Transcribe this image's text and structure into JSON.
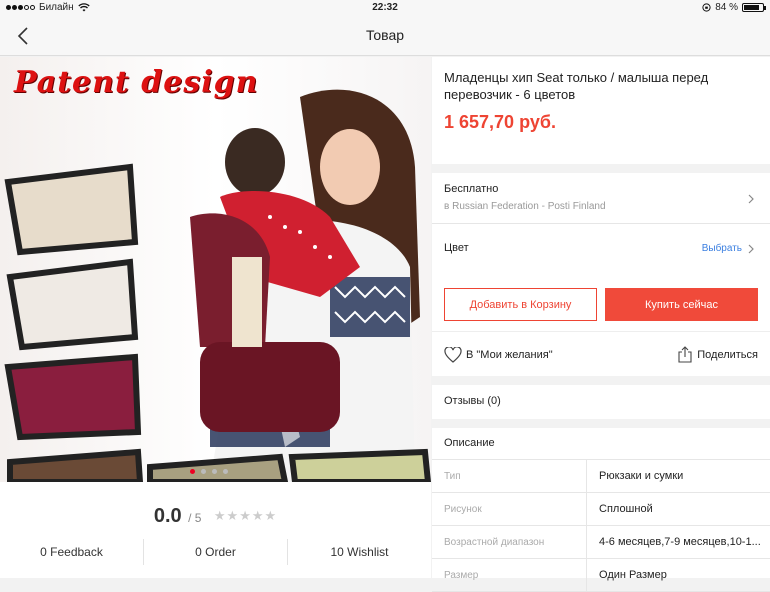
{
  "status": {
    "carrier": "Билайн",
    "time": "22:32",
    "battery": "84 %",
    "battery_level": 0.84
  },
  "nav": {
    "title": "Товар"
  },
  "product": {
    "image_caption": "Patent design",
    "image_count": 4,
    "image_active_index": 0,
    "title": "Младенцы хип Seat только / малыша перед перевозчик - 6 цветов",
    "price": "1 657,70 руб."
  },
  "rating": {
    "score": "0.0",
    "of": "/ 5",
    "stars": "★★★★★",
    "stars_filled": 0
  },
  "stats": [
    {
      "label": "0 Feedback"
    },
    {
      "label": "0 Order"
    },
    {
      "label": "10 Wishlist"
    }
  ],
  "shipping": {
    "cost": "Бесплатно",
    "method": "в Russian Federation - Posti Finland"
  },
  "color": {
    "label": "Цвет",
    "choose": "Выбрать"
  },
  "actions": {
    "add_to_cart": "Добавить в Корзину",
    "buy_now": "Купить сейчас",
    "wishlist": "В \"Мои желания\"",
    "share": "Поделиться"
  },
  "reviews": {
    "label": "Отзывы (0)"
  },
  "description": {
    "title": "Описание",
    "rows": [
      {
        "key": "Тип",
        "value": "Рюкзаки и сумки"
      },
      {
        "key": "Рисунок",
        "value": "Сплошной"
      },
      {
        "key": "Возрастной диапазон",
        "value": "4-6 месяцев,7-9 месяцев,10-1..."
      },
      {
        "key": "Размер",
        "value": "Один Размер"
      }
    ]
  },
  "colors": {
    "accent": "#f04a3a",
    "link": "#3b7fe0"
  }
}
